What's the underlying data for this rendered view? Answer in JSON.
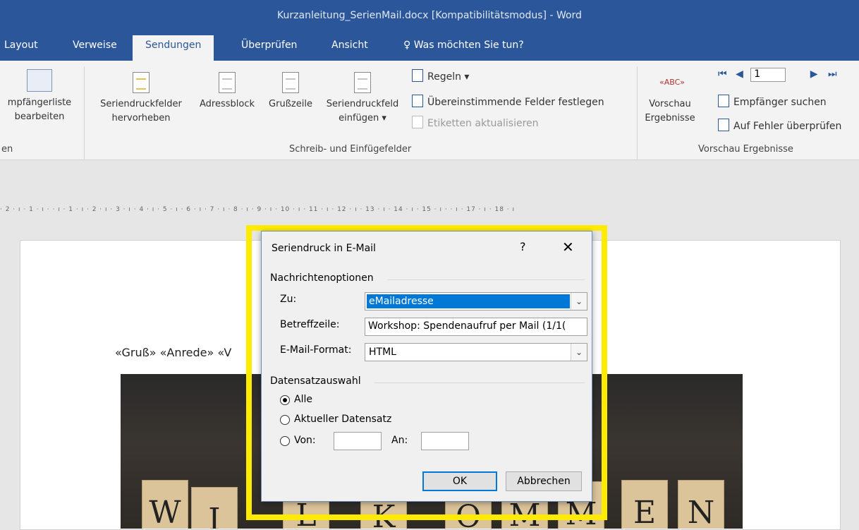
{
  "window": {
    "title": "Kurzanleitung_SerienMail.docx [Kompatibilitätsmodus] - Word"
  },
  "tabs": [
    {
      "label": "Layout"
    },
    {
      "label": "Verweise"
    },
    {
      "label": "Sendungen"
    },
    {
      "label": "Überprüfen"
    },
    {
      "label": "Ansicht"
    }
  ],
  "tell_me": {
    "label": "Was möchten Sie tun?",
    "icon": "lightbulb-icon"
  },
  "ribbon": {
    "recipients": {
      "line1": "mpfängerliste",
      "line2": "bearbeiten",
      "group": "en"
    },
    "highlight_fields": {
      "line1": "Seriendruckfelder",
      "line2": "hervorheben"
    },
    "address_block": {
      "label": "Adressblock"
    },
    "greeting_line": {
      "label": "Grußzeile"
    },
    "insert_field": {
      "line1": "Seriendruckfeld",
      "line2": "einfügen ▾"
    },
    "rules": {
      "label": "Regeln ▾"
    },
    "match_fields": {
      "label": "Übereinstimmende Felder festlegen"
    },
    "update_labels": {
      "label": "Etiketten aktualisieren"
    },
    "write_group": {
      "label": "Schreib- und Einfügefelder"
    },
    "preview": {
      "line1": "Vorschau",
      "line2": "Ergebnisse"
    },
    "record_number": "1",
    "find_recipient": {
      "label": "Empfänger suchen"
    },
    "check_errors": {
      "label": "Auf Fehler überprüfen"
    },
    "preview_group": {
      "label": "Vorschau Ergebnisse"
    }
  },
  "ruler": {
    "text": "· 2 · ı · 1 · ı ·     · ı · 1 · ı · 2 · ı · 3 · ı · 4 · ı · 5 · ı · 6 · ı · 7 · ı · 8 · ı · 9 · ı · 10 · ı · 11 · ı · 12 · ı · 13 · ı · 14 · ı · 15 · ı ·     · ı · 17 · ı · 18 · ı"
  },
  "document": {
    "merge_line": "«Gruß» «Anrede» «V",
    "photo_tiles": [
      "W",
      "I",
      "L",
      "K",
      "O",
      "M",
      "M",
      "E",
      "N"
    ]
  },
  "dialog": {
    "title": "Seriendruck in E-Mail",
    "help": "?",
    "close": "✕",
    "options_group": "Nachrichtenoptionen",
    "to_label": "Zu:",
    "to_value": "eMailadresse",
    "subject_label": "Betreffzeile:",
    "subject_value": "Workshop: Spendenaufruf per Mail (1/1(",
    "format_label": "E-Mail-Format:",
    "format_value": "HTML",
    "records_group": "Datensatzauswahl",
    "radio_all": "Alle",
    "radio_current": "Aktueller Datensatz",
    "radio_from": "Von:",
    "to_range_label": "An:",
    "ok": "OK",
    "cancel": "Abbrechen",
    "selected_radio": "Alle"
  },
  "colors": {
    "accent": "#2b579a",
    "highlight": "#ffeb00",
    "selection": "#0078d7"
  }
}
